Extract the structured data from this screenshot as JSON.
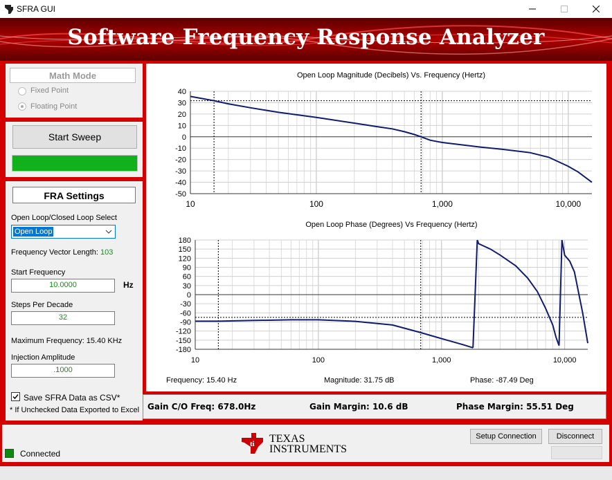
{
  "window": {
    "title": "SFRA GUI"
  },
  "banner": {
    "title": "Software Frequency Response Analyzer"
  },
  "math_mode": {
    "title": "Math Mode",
    "options": [
      "Fixed Point",
      "Floating Point"
    ]
  },
  "sweep": {
    "start_label": "Start Sweep",
    "progress": 1.0,
    "progress_color": "#11b11b"
  },
  "settings": {
    "title": "FRA Settings",
    "loop_select_label": "Open Loop/Closed Loop Select",
    "loop_select_value": "Open Loop",
    "freq_vector_label": "Frequency Vector Length:",
    "freq_vector_value": "103",
    "start_freq_label": "Start Frequency",
    "start_freq_value": "10.0000",
    "start_freq_unit": "Hz",
    "steps_label": "Steps Per Decade",
    "steps_value": "32",
    "max_freq_label": "Maximum Frequency: 15.40 KHz",
    "inj_amp_label": "Injection Amplitude",
    "inj_amp_value": ".1000",
    "save_csv_label": "Save SFRA Data as CSV*",
    "save_csv_checked": true,
    "csv_note": "* If Unchecked Data Exported to Excel"
  },
  "readout": {
    "frequency": "Frequency: 15.40 Hz",
    "magnitude": "Magnitude: 31.75 dB",
    "phase": "Phase: -87.49 Deg"
  },
  "results": {
    "gain_co": "Gain C/O Freq: 678.0Hz",
    "gain_margin": "Gain Margin: 10.6 dB",
    "phase_margin": "Phase Margin: 55.51 Deg"
  },
  "footer": {
    "connected_label": "Connected",
    "status_color": "#118811",
    "setup_button": "Setup Connection",
    "disconnect_button": "Disconnect",
    "logo_line1": "Texas",
    "logo_line2": "Instruments"
  },
  "chart_data": [
    {
      "type": "line",
      "title": "Open Loop Magnitude (Decibels) Vs. Frequency (Hertz)",
      "x_scale": "log",
      "xlim": [
        10,
        15400
      ],
      "ylim": [
        -50,
        40
      ],
      "yticks": [
        40,
        30,
        20,
        10,
        0,
        -10,
        -20,
        -30,
        -40,
        -50
      ],
      "xticks": [
        "10",
        "100",
        "1,000",
        "10,000"
      ],
      "grid": true,
      "cursor_x": [
        15.4,
        678
      ],
      "cursor_y": [
        31.75
      ],
      "series": [
        {
          "color": "#0f1b6e",
          "x": [
            10,
            15.4,
            20,
            30,
            50,
            100,
            200,
            300,
            400,
            500,
            600,
            678,
            800,
            1000,
            2000,
            3000,
            5000,
            7000,
            10000,
            12000,
            15400
          ],
          "y": [
            35.5,
            31.75,
            29,
            25.5,
            21.5,
            17,
            12,
            9,
            7,
            4.5,
            2,
            0,
            -3,
            -5,
            -9,
            -11,
            -14,
            -18,
            -26,
            -31,
            -40
          ]
        }
      ]
    },
    {
      "type": "line",
      "title": "Open Loop Phase (Degrees) Vs Frequency (Hertz)",
      "x_scale": "log",
      "xlim": [
        10,
        15400
      ],
      "ylim": [
        -180,
        180
      ],
      "yticks": [
        180,
        150,
        120,
        90,
        60,
        30,
        0,
        -30,
        -60,
        -90,
        -120,
        -150,
        -180
      ],
      "xticks": [
        "10",
        "100",
        "1,000",
        "10,000"
      ],
      "grid": true,
      "cursor_x": [
        15.4,
        678
      ],
      "cursor_y": [
        -75
      ],
      "series": [
        {
          "color": "#0f1b6e",
          "segments": [
            {
              "x": [
                10,
                15.4,
                30,
                60,
                100,
                200,
                400,
                678,
                1000,
                1500,
                1800
              ],
              "y": [
                -87.5,
                -87.5,
                -85,
                -83,
                -83,
                -88,
                -100,
                -125,
                -145,
                -165,
                -175
              ]
            },
            {
              "x": [
                1800,
                1950
              ],
              "y": [
                -175,
                180
              ]
            },
            {
              "x": [
                1950,
                2000,
                2500,
                3000,
                4000,
                5000,
                6000,
                7000,
                8000,
                8500,
                9000
              ],
              "y": [
                180,
                168,
                150,
                130,
                95,
                55,
                10,
                -45,
                -100,
                -140,
                -168
              ]
            },
            {
              "x": [
                9000,
                9500
              ],
              "y": [
                -168,
                180
              ]
            },
            {
              "x": [
                9500,
                10000,
                11000,
                12000,
                14000,
                15400
              ],
              "y": [
                180,
                130,
                110,
                75,
                -60,
                -160
              ]
            }
          ]
        }
      ]
    }
  ]
}
